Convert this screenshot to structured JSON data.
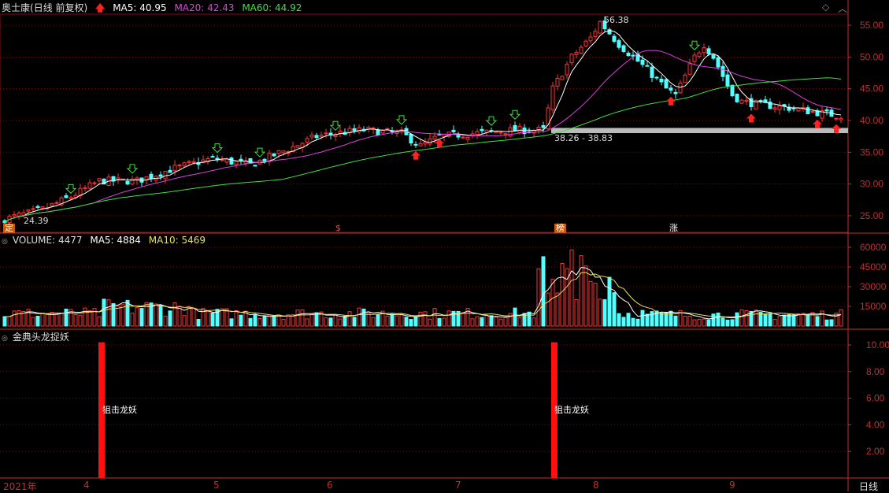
{
  "stock": {
    "name": "奥士康",
    "mode": "(日线 前复权)"
  },
  "ma_main": [
    {
      "label": "MA5: 40.95",
      "color": "#ffffff"
    },
    {
      "label": "MA20: 42.43",
      "color": "#e040e0"
    },
    {
      "label": "MA60: 44.92",
      "color": "#40e040"
    }
  ],
  "volume_header": {
    "title": "VOLUME: 4477",
    "ma5": "MA5: 4884",
    "ma10": "MA10: 5469",
    "ma5_color": "#ffffff",
    "ma10_color": "#e8e060"
  },
  "indicator": {
    "title": "金典头龙捉妖",
    "signal_label": "狙击龙妖",
    "signal_color": "#ff1010"
  },
  "price_axis": [
    "55.00",
    "50.00",
    "45.00",
    "40.00",
    "35.00",
    "30.00",
    "25.00"
  ],
  "volume_axis": [
    "60000",
    "45000",
    "30000",
    "15000"
  ],
  "indicator_axis": [
    "10.00",
    "8.00",
    "6.00",
    "4.00",
    "2.00"
  ],
  "annotations": {
    "high": "56.38",
    "low": "24.39",
    "range": "38.26 - 38.83"
  },
  "event_tags": [
    "定",
    "$",
    "榜",
    "涨"
  ],
  "x_axis": [
    "2021年",
    "4",
    "5",
    "6",
    "7",
    "8",
    "9"
  ],
  "period_button": "日线",
  "colors": {
    "up": "#ff3232",
    "down": "#54ffff",
    "grid": "#7a1010",
    "axis": "#c03030"
  }
}
